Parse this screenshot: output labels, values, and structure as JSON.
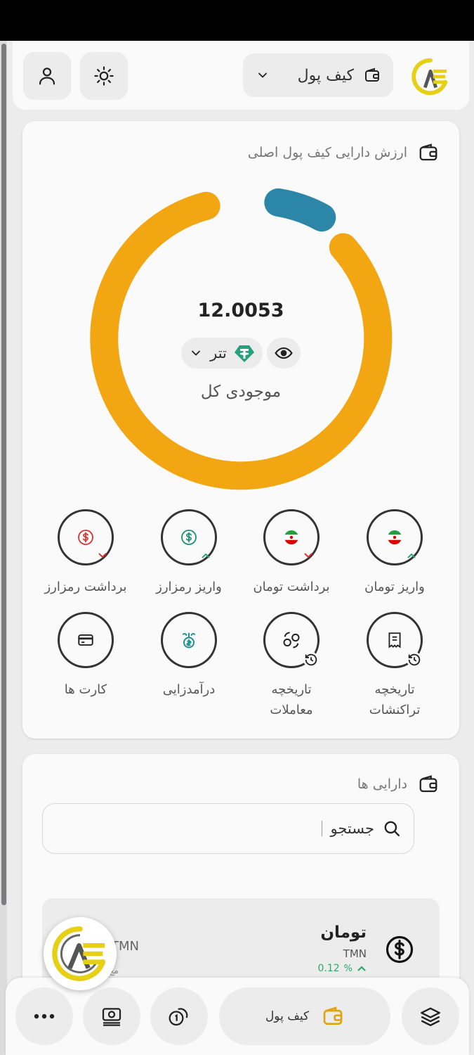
{
  "header": {
    "wallet_selector_label": "کیف پول"
  },
  "wallet_card": {
    "title": "ارزش دارایی کیف پول اصلی",
    "balance": "12.0053",
    "currency": "تتر",
    "total_label": "موجودی کل",
    "colors": {
      "main_segment": "#F2A612",
      "minor_segment": "#2C86A8"
    }
  },
  "actions": [
    {
      "label": "واریز تومان"
    },
    {
      "label": "برداشت تومان"
    },
    {
      "label": "واریز رمزارز"
    },
    {
      "label": "برداشت رمزارز"
    },
    {
      "label_line1": "تاریخچه",
      "label_line2": "تراکنشات"
    },
    {
      "label_line1": "تاریخچه",
      "label_line2": "معاملات"
    },
    {
      "label": "درآمدزایی"
    },
    {
      "label": "کارت ها"
    }
  ],
  "assets_card": {
    "title": "دارایی ها",
    "search_text": "جستجو",
    "rows": [
      {
        "name": "تومان",
        "symbol": "TMN",
        "change": "0.12",
        "change_unit": "%",
        "right_symbol": "TMN",
        "sub": "مع"
      }
    ]
  },
  "bottom_nav": {
    "active_label": "کیف پول"
  }
}
